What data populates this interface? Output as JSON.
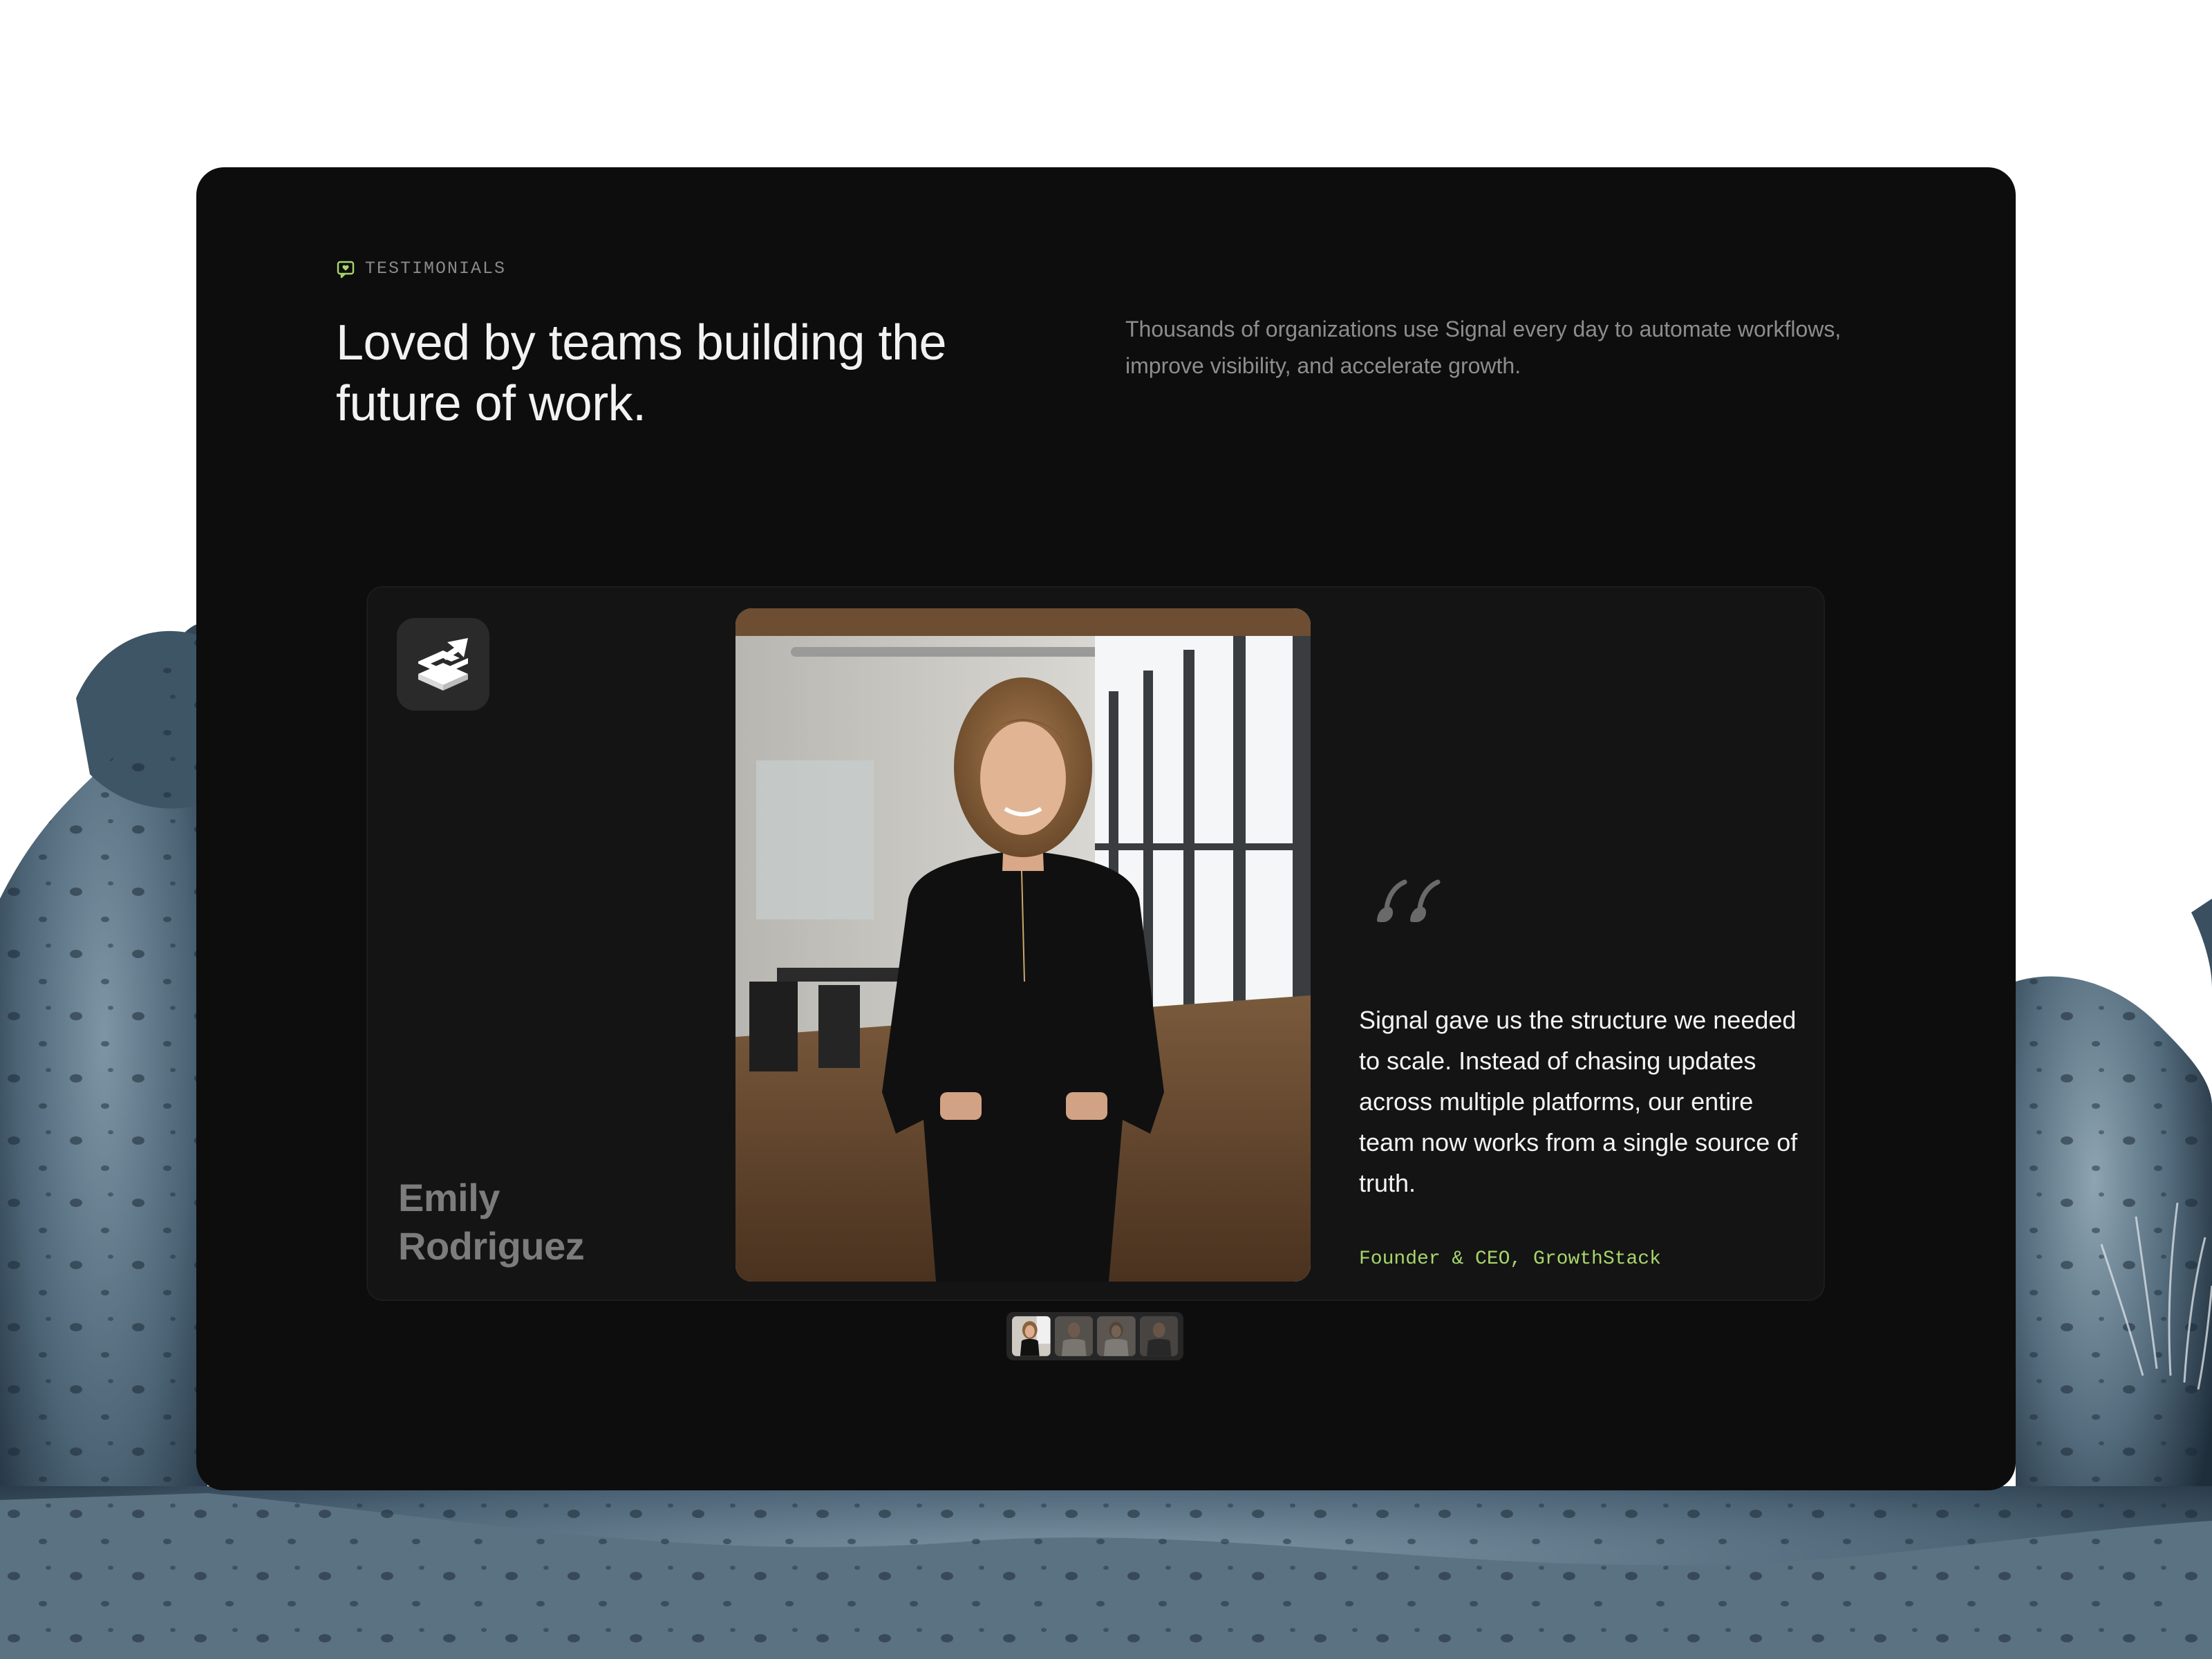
{
  "section": {
    "eyebrow_icon": "chat-heart-icon",
    "eyebrow": "TESTIMONIALS",
    "headline": "Loved by teams building the future of work.",
    "intro": "Thousands of organizations use Signal every day to automate workflows, improve visibility, and accelerate growth."
  },
  "testimonial": {
    "company_logo_icon": "growthstack-logo-icon",
    "name": "Emily Rodriguez",
    "quote_icon": "quote-icon",
    "quote": "Signal gave us the structure we needed to scale. Instead of chasing updates across multiple platforms, our entire team now works from a single source of truth.",
    "role": "Founder & CEO, GrowthStack"
  },
  "carousel": {
    "active_index": 0,
    "count": 4
  },
  "colors": {
    "card_bg": "#0d0d0d",
    "panel_bg": "#141414",
    "accent": "#a8d66b",
    "rock": "#4a6273"
  }
}
